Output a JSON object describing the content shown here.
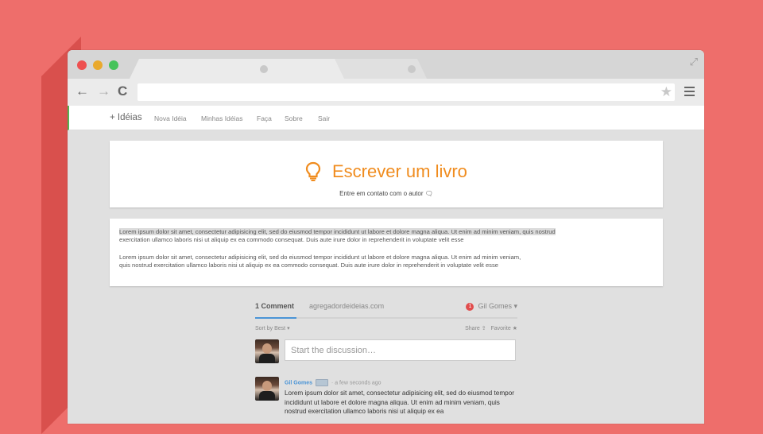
{
  "colors": {
    "background": "#ee6e6b",
    "accent": "#f08c1e",
    "link": "#4a94d6",
    "nav_accent": "#54b254"
  },
  "browser": {
    "window_controls": [
      "close",
      "minimize",
      "maximize"
    ],
    "tabs": [
      {
        "label": ""
      },
      {
        "label": ""
      }
    ],
    "url": "",
    "icons": [
      "back-arrow-icon",
      "forward-arrow-icon",
      "reload-icon",
      "star-icon",
      "hamburger-menu-icon",
      "expand-icon"
    ]
  },
  "nav": {
    "brand": "+ Idéias",
    "links": [
      "Nova Idéia",
      "Minhas Idéias",
      "Faça",
      "Sobre",
      "Sair"
    ]
  },
  "idea": {
    "icon": "lightbulb-icon",
    "title": "Escrever um livro",
    "contact": "Entre em contato com o autor"
  },
  "body": {
    "para1_highlight": "Lorem ipsum dolor sit amet, consectetur adipisicing elit, sed do eiusmod tempor incididunt ut labore et dolore magna aliqua. Ut enim ad minim veniam, quis nostrud",
    "para1_rest": "exercitation ullamco laboris nisi ut aliquip ex ea commodo consequat. Duis aute irure dolor in reprehenderit in voluptate velit esse",
    "para2_line1": "Lorem ipsum dolor sit amet, consectetur adipisicing elit, sed do eiusmod tempor incididunt ut labore et dolore magna aliqua. Ut enim ad minim veniam,",
    "para2_line2": "quis nostrud exercitation ullamco laboris nisi ut aliquip ex ea commodo consequat. Duis aute irure dolor in reprehenderit in voluptate velit esse"
  },
  "comments": {
    "count_label": "1 Comment",
    "site": "agregadordeideias.com",
    "notifications": "1",
    "user": "Gil Gomes",
    "sort": "Sort by Best",
    "share": "Share",
    "favorite": "Favorite",
    "input_placeholder": "Start the discussion…",
    "items": [
      {
        "author": "Gil Gomes",
        "time": "a few seconds ago",
        "text": "Lorem ipsum dolor sit amet, consectetur adipisicing elit, sed do eiusmod tempor incididunt ut labore et dolore magna aliqua. Ut enim ad minim veniam, quis nostrud exercitation ullamco laboris nisi ut aliquip ex ea"
      }
    ]
  }
}
